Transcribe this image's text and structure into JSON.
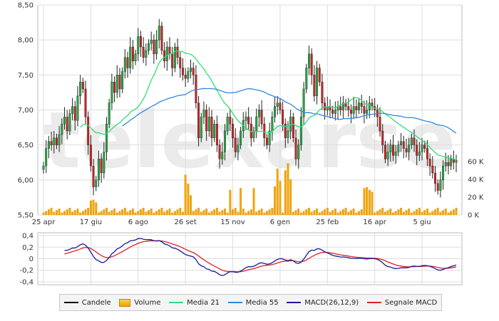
{
  "chart_data": {
    "type": "candlestick",
    "price_axis": {
      "ylim": [
        5.5,
        8.5
      ],
      "ticks": [
        "5,50",
        "6,00",
        "6,50",
        "7,00",
        "7,50",
        "8,00",
        "8,50"
      ]
    },
    "volume_axis": {
      "ylim": [
        0,
        80000
      ],
      "ticks": [
        "0 K",
        "20 K",
        "40 K",
        "60 K"
      ]
    },
    "macd_axis": {
      "ylim": [
        -0.45,
        0.45
      ],
      "ticks": [
        "0,4",
        "0,2",
        "0",
        "-0,2",
        "-0,4"
      ]
    },
    "x_tick_labels": [
      "25 apr",
      "17 giu",
      "6 ago",
      "26 set",
      "15 nov",
      "6 gen",
      "25 feb",
      "16 apr",
      "5 giu"
    ],
    "x_tick_index": [
      0,
      18,
      36,
      54,
      72,
      90,
      108,
      126,
      144
    ],
    "series_close": [
      6.2,
      6.45,
      6.55,
      6.5,
      6.6,
      6.5,
      6.65,
      6.8,
      6.9,
      6.7,
      6.95,
      7.05,
      6.85,
      7.2,
      7.4,
      7.3,
      6.9,
      6.5,
      6.2,
      5.9,
      6.0,
      6.3,
      6.1,
      6.4,
      6.8,
      7.1,
      7.4,
      7.25,
      7.5,
      7.3,
      7.55,
      7.75,
      7.6,
      7.9,
      7.7,
      7.8,
      8.05,
      7.9,
      7.75,
      7.85,
      7.95,
      8.0,
      7.8,
      8.0,
      8.2,
      7.85,
      7.7,
      7.9,
      7.8,
      7.6,
      7.9,
      7.75,
      7.6,
      7.5,
      7.45,
      7.55,
      7.6,
      7.5,
      7.1,
      6.6,
      6.9,
      7.0,
      6.7,
      6.9,
      6.6,
      6.8,
      6.5,
      6.3,
      6.4,
      6.7,
      6.9,
      6.8,
      6.6,
      6.4,
      6.5,
      6.7,
      6.85,
      6.9,
      6.8,
      6.6,
      6.7,
      6.9,
      7.0,
      6.8,
      6.6,
      6.5,
      6.7,
      6.9,
      7.05,
      7.1,
      7.0,
      6.8,
      6.6,
      6.7,
      6.9,
      6.6,
      6.3,
      6.5,
      6.9,
      7.3,
      7.6,
      7.8,
      7.5,
      7.2,
      7.6,
      7.4,
      7.1,
      7.0,
      7.05,
      7.0,
      6.95,
      7.0,
      7.05,
      7.0,
      7.1,
      7.05,
      7.0,
      6.95,
      7.05,
      7.0,
      7.1,
      7.05,
      6.95,
      7.0,
      7.1,
      7.05,
      7.0,
      6.9,
      6.7,
      6.5,
      6.3,
      6.4,
      6.5,
      6.35,
      6.4,
      6.5,
      6.55,
      6.45,
      6.4,
      6.5,
      6.6,
      6.5,
      6.35,
      6.4,
      6.5,
      6.45,
      6.3,
      6.2,
      6.1,
      5.95,
      5.85,
      6.0,
      6.2,
      6.25,
      6.2,
      6.3,
      6.25,
      6.28
    ],
    "series_open": [
      6.15,
      6.2,
      6.45,
      6.55,
      6.5,
      6.6,
      6.5,
      6.65,
      6.8,
      6.9,
      6.7,
      6.95,
      7.05,
      6.85,
      7.2,
      7.4,
      7.3,
      6.9,
      6.5,
      6.2,
      5.9,
      6.0,
      6.3,
      6.1,
      6.4,
      6.8,
      7.1,
      7.4,
      7.25,
      7.5,
      7.3,
      7.55,
      7.75,
      7.6,
      7.9,
      7.7,
      7.8,
      8.05,
      7.9,
      7.75,
      7.85,
      7.95,
      8.0,
      7.8,
      8.0,
      8.2,
      7.85,
      7.7,
      7.9,
      7.8,
      7.6,
      7.9,
      7.75,
      7.6,
      7.5,
      7.45,
      7.55,
      7.6,
      7.5,
      7.1,
      6.6,
      6.9,
      7.0,
      6.7,
      6.9,
      6.6,
      6.8,
      6.5,
      6.3,
      6.4,
      6.7,
      6.9,
      6.8,
      6.6,
      6.4,
      6.5,
      6.7,
      6.85,
      6.9,
      6.8,
      6.6,
      6.7,
      6.9,
      7.0,
      6.8,
      6.6,
      6.5,
      6.7,
      6.9,
      7.05,
      7.1,
      7.0,
      6.8,
      6.6,
      6.7,
      6.9,
      6.6,
      6.3,
      6.5,
      6.9,
      7.3,
      7.6,
      7.8,
      7.5,
      7.2,
      7.6,
      7.4,
      7.1,
      7.0,
      7.05,
      7.0,
      6.95,
      7.0,
      7.05,
      7.0,
      7.1,
      7.05,
      7.0,
      6.95,
      7.05,
      7.0,
      7.1,
      7.05,
      6.95,
      7.0,
      7.1,
      7.05,
      7.0,
      6.9,
      6.7,
      6.5,
      6.3,
      6.4,
      6.5,
      6.35,
      6.4,
      6.5,
      6.55,
      6.45,
      6.4,
      6.5,
      6.6,
      6.5,
      6.35,
      6.4,
      6.5,
      6.45,
      6.3,
      6.2,
      6.1,
      5.95,
      5.85,
      6.0,
      6.2,
      6.25,
      6.2,
      6.3,
      6.25
    ],
    "volume_spikes": {
      "54": 45000,
      "55": 35000,
      "56": 22000,
      "71": 28000,
      "75": 30000,
      "80": 30000,
      "88": 32000,
      "89": 52000,
      "90": 38000,
      "92": 50000,
      "93": 58000,
      "94": 40000,
      "122": 30000,
      "123": 31000,
      "124": 28000,
      "125": 26000,
      "18": 16000,
      "19": 17000,
      "20": 14000
    },
    "legend": [
      {
        "name": "Candele",
        "color": "#000000",
        "kind": "line"
      },
      {
        "name": "Volume",
        "color": "#f5a400",
        "kind": "box"
      },
      {
        "name": "Media 21",
        "color": "#33dd77",
        "kind": "line"
      },
      {
        "name": "Media 55",
        "color": "#3388dd",
        "kind": "line"
      },
      {
        "name": "MACD(26,12,9)",
        "color": "#1a1a99",
        "kind": "line"
      },
      {
        "name": "Segnale MACD",
        "color": "#dd2222",
        "kind": "line"
      }
    ],
    "colors": {
      "up": "#22aa44",
      "down": "#cc2222",
      "grid": "#dddddd",
      "volume": "#f5a400",
      "watermark": "#ebebeb"
    }
  }
}
